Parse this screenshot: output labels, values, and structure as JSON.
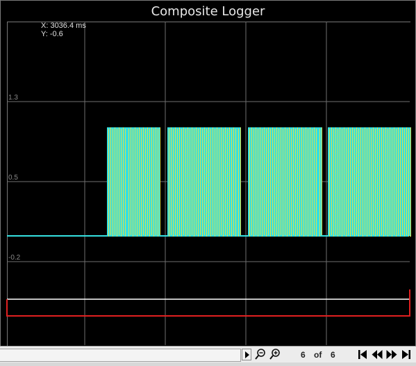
{
  "window": {
    "title": "Composite Logger"
  },
  "readout": {
    "x_label": "X: 3036.4 ms",
    "y_label": "Y: -0.6"
  },
  "axis": {
    "y_ticks": [
      "1.3",
      "0.5",
      "-0.2"
    ]
  },
  "pager": {
    "current": "6",
    "of_label": "of",
    "total": "6"
  },
  "colors": {
    "background": "#000000",
    "grid": "#6f6f6f",
    "trace_primary": "#35e0e0",
    "trace_secondary": "#e0e04a",
    "trace_white": "#ffffff",
    "trace_red": "#e02020"
  },
  "icons": {
    "scroll_right": "triangle-right",
    "zoom_out": "magnifier-minus",
    "zoom_in": "magnifier-plus",
    "first": "skip-first",
    "prev": "rewind",
    "next": "fast-forward",
    "last": "skip-last"
  }
}
